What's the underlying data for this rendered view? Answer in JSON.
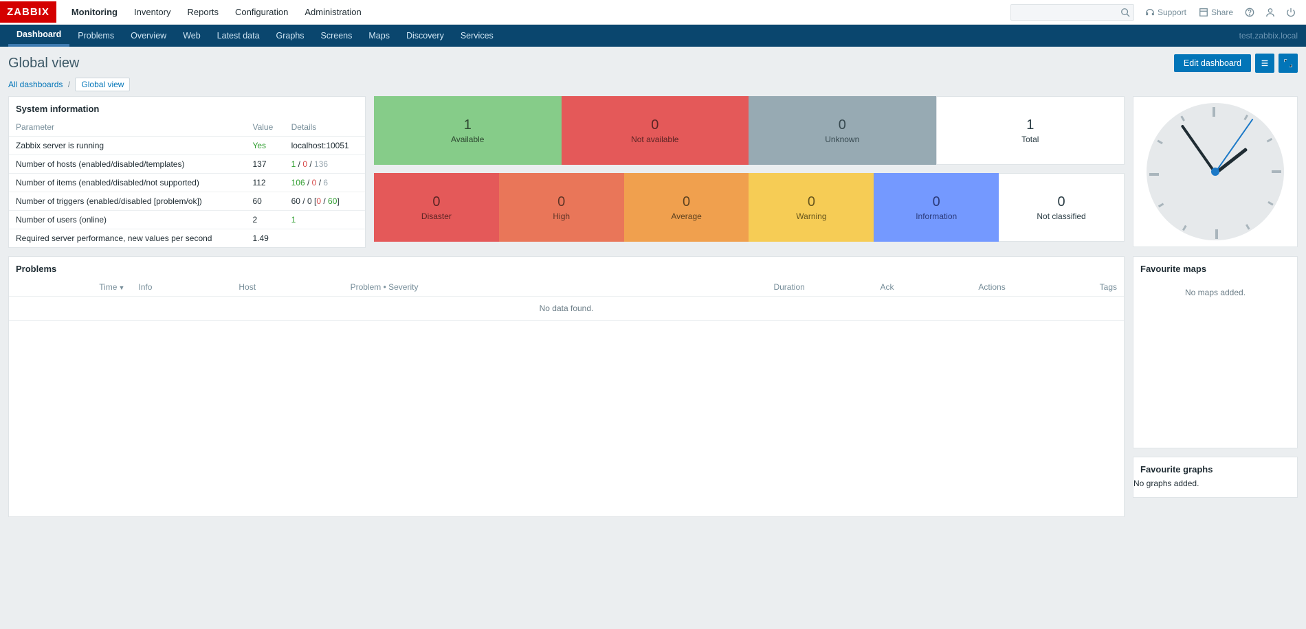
{
  "brand": "ZABBIX",
  "topnav": [
    "Monitoring",
    "Inventory",
    "Reports",
    "Configuration",
    "Administration"
  ],
  "topnav_active": 0,
  "support_label": "Support",
  "share_label": "Share",
  "subnav": [
    "Dashboard",
    "Problems",
    "Overview",
    "Web",
    "Latest data",
    "Graphs",
    "Screens",
    "Maps",
    "Discovery",
    "Services"
  ],
  "subnav_active": 0,
  "host_label": "test.zabbix.local",
  "page_title": "Global view",
  "edit_button": "Edit dashboard",
  "breadcrumbs": {
    "all": "All dashboards",
    "current": "Global view"
  },
  "sysinfo": {
    "title": "System information",
    "headers": [
      "Parameter",
      "Value",
      "Details"
    ],
    "rows": [
      {
        "p": "Zabbix server is running",
        "v": "Yes",
        "v_cls": "green",
        "d_html": "localhost:10051"
      },
      {
        "p": "Number of hosts (enabled/disabled/templates)",
        "v": "137",
        "d_html": "<span class='green'>1</span> / <span class='red'>0</span> / <span class='grey'>136</span>"
      },
      {
        "p": "Number of items (enabled/disabled/not supported)",
        "v": "112",
        "d_html": "<span class='green'>106</span> / <span class='red'>0</span> / <span class='grey'>6</span>"
      },
      {
        "p": "Number of triggers (enabled/disabled [problem/ok])",
        "v": "60",
        "d_html": "60 / 0 [<span class='red'>0</span> / <span class='green'>60</span>]"
      },
      {
        "p": "Number of users (online)",
        "v": "2",
        "d_html": "<span class='green'>1</span>"
      },
      {
        "p": "Required server performance, new values per second",
        "v": "1.49",
        "d_html": ""
      }
    ]
  },
  "host_tiles": [
    {
      "num": "1",
      "lbl": "Available",
      "cls": "c-avail"
    },
    {
      "num": "0",
      "lbl": "Not available",
      "cls": "c-navail"
    },
    {
      "num": "0",
      "lbl": "Unknown",
      "cls": "c-unknown"
    },
    {
      "num": "1",
      "lbl": "Total",
      "cls": "c-total"
    }
  ],
  "sev_tiles": [
    {
      "num": "0",
      "lbl": "Disaster",
      "cls": "c-disaster"
    },
    {
      "num": "0",
      "lbl": "High",
      "cls": "c-high"
    },
    {
      "num": "0",
      "lbl": "Average",
      "cls": "c-average"
    },
    {
      "num": "0",
      "lbl": "Warning",
      "cls": "c-warning"
    },
    {
      "num": "0",
      "lbl": "Information",
      "cls": "c-info"
    },
    {
      "num": "0",
      "lbl": "Not classified",
      "cls": "c-notclass"
    }
  ],
  "clock": {
    "hour_deg": 52,
    "min_deg": 325,
    "sec_deg": 35
  },
  "problems": {
    "title": "Problems",
    "headers": [
      "Time",
      "Info",
      "Host",
      "Problem • Severity",
      "Duration",
      "Ack",
      "Actions",
      "Tags"
    ],
    "sort_col": 0,
    "nodata": "No data found."
  },
  "fav_maps": {
    "title": "Favourite maps",
    "empty": "No maps added."
  },
  "fav_graphs": {
    "title": "Favourite graphs",
    "empty": "No graphs added."
  }
}
